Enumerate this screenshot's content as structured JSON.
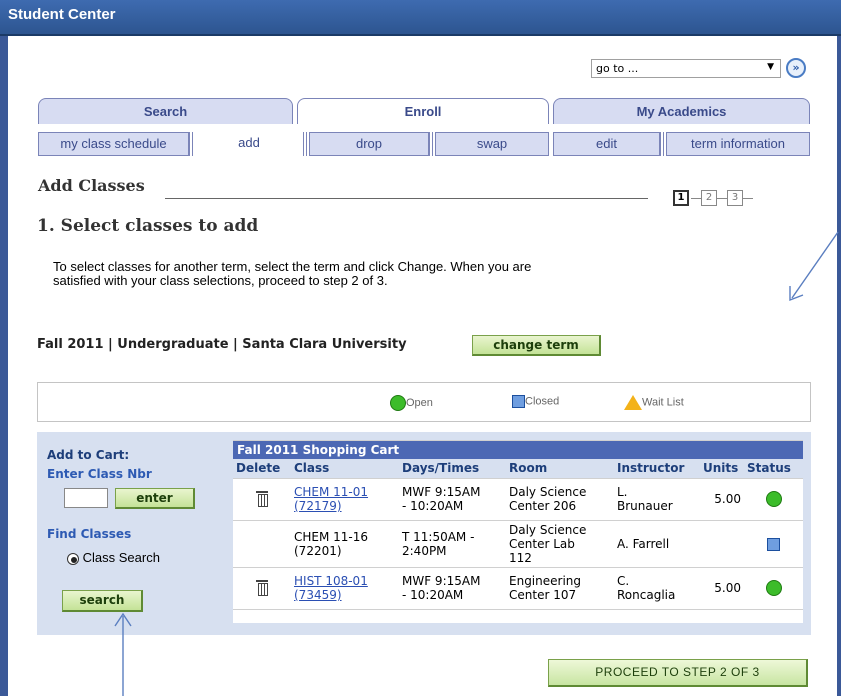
{
  "window": {
    "title": "Student Center"
  },
  "goto": {
    "value": "go to ...",
    "button": "»"
  },
  "tabs": [
    {
      "label": "Search"
    },
    {
      "label": "Enroll"
    },
    {
      "label": "My Academics"
    }
  ],
  "subtabs": [
    {
      "label": "my class schedule"
    },
    {
      "label": "add"
    },
    {
      "label": "drop"
    },
    {
      "label": "swap"
    },
    {
      "label": "edit"
    },
    {
      "label": "term information"
    }
  ],
  "page": {
    "title": "Add Classes",
    "steps": [
      "1",
      "2",
      "3"
    ],
    "subtitle": "1.  Select classes to add",
    "instructions_line1": "To select classes for another term, select the term and click Change.  When you are",
    "instructions_line2": "satisfied with your class selections, proceed to step 2 of 3.",
    "term": "Fall 2011 | Undergraduate | Santa Clara University",
    "change_term": "change term"
  },
  "legend": {
    "open": "Open",
    "closed": "Closed",
    "wait_list": "Wait List"
  },
  "left_panel": {
    "add_to_cart": "Add to Cart:",
    "enter_class_nbr": "Enter Class Nbr",
    "enter": "enter",
    "find_classes": "Find Classes",
    "class_search": "Class Search",
    "search": "search"
  },
  "cart": {
    "title": "Fall 2011 Shopping Cart",
    "headers": [
      "Delete",
      "Class",
      "Days/Times",
      "Room",
      "Instructor",
      "Units",
      "Status"
    ],
    "rows": [
      {
        "class_line1": "CHEM 11-01",
        "class_line2": "(72179)",
        "days_line1": "MWF 9:15AM",
        "days_line2": "- 10:20AM",
        "room_line1": "Daly Science",
        "room_line2": "Center 206",
        "room_line3": "",
        "instr_line1": "L.",
        "instr_line2": "Brunauer",
        "units": "5.00",
        "status": "open",
        "link": true,
        "delete": true
      },
      {
        "class_line1": "CHEM 11-16",
        "class_line2": "(72201)",
        "days_line1": "T 11:50AM -",
        "days_line2": "2:40PM",
        "room_line1": "Daly Science",
        "room_line2": "Center Lab",
        "room_line3": "112",
        "instr_line1": "A. Farrell",
        "instr_line2": "",
        "units": "",
        "status": "closed",
        "link": false,
        "delete": false
      },
      {
        "class_line1": "HIST 108-01",
        "class_line2": "(73459)",
        "days_line1": "MWF 9:15AM",
        "days_line2": "- 10:20AM",
        "room_line1": "Engineering",
        "room_line2": "Center 107",
        "room_line3": "",
        "instr_line1": "C.",
        "instr_line2": "Roncaglia",
        "units": "5.00",
        "status": "open",
        "link": true,
        "delete": true
      }
    ]
  },
  "proceed": "PROCEED TO STEP 2 OF 3",
  "colors": {
    "header_blue": "#4c68b4",
    "tab_blue": "#d7dcf2",
    "button_green": "#c4e397",
    "open_green": "#3cbc2a",
    "closed_blue": "#6f9ee0",
    "wait_yellow": "#f3b21a"
  }
}
